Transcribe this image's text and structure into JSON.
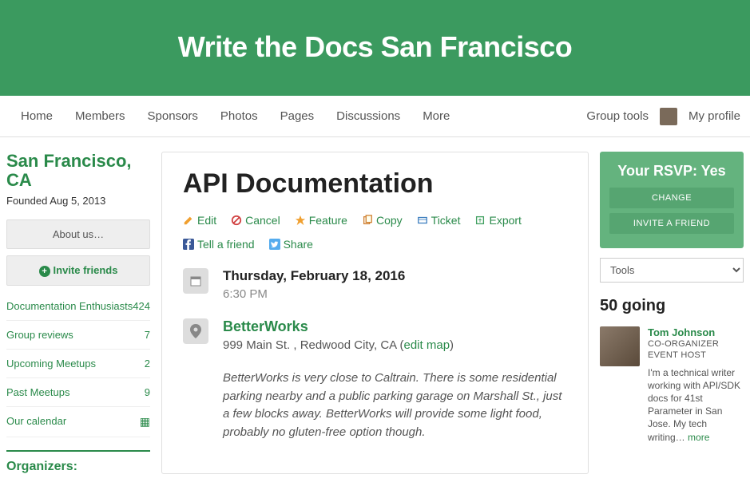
{
  "banner": {
    "title": "Write the Docs San Francisco"
  },
  "nav": {
    "left": [
      "Home",
      "Members",
      "Sponsors",
      "Photos",
      "Pages",
      "Discussions",
      "More"
    ],
    "group_tools": "Group tools",
    "my_profile": "My profile"
  },
  "sidebar": {
    "location": "San Francisco, CA",
    "founded": "Founded Aug 5, 2013",
    "about_btn": "About us…",
    "invite_btn": "Invite friends",
    "stats": [
      {
        "label": "Documentation Enthusiasts",
        "count": "424"
      },
      {
        "label": "Group reviews",
        "count": "7"
      },
      {
        "label": "Upcoming Meetups",
        "count": "2"
      },
      {
        "label": "Past Meetups",
        "count": "9"
      }
    ],
    "calendar_label": "Our calendar",
    "organizers_label": "Organizers:"
  },
  "event": {
    "title": "API Documentation",
    "actions": {
      "edit": "Edit",
      "cancel": "Cancel",
      "feature": "Feature",
      "copy": "Copy",
      "ticket": "Ticket",
      "export": "Export",
      "tell_friend": "Tell a friend",
      "share": "Share"
    },
    "date": "Thursday, February 18, 2016",
    "time": "6:30 PM",
    "venue": "BetterWorks",
    "address": "999 Main St. , Redwood City, CA",
    "edit_map": "edit map",
    "description": "BetterWorks is very close to Caltrain. There is some residential parking nearby and a public parking garage on Marshall St., just a few blocks away. BetterWorks will provide some light food, probably no gluten-free option though."
  },
  "rsvp": {
    "title": "Your RSVP: Yes",
    "change": "CHANGE",
    "invite": "INVITE A FRIEND",
    "tools": "Tools",
    "going_count": "50 going",
    "attendee": {
      "name": "Tom Johnson",
      "role1": "CO-ORGANIZER",
      "role2": "EVENT HOST",
      "bio": "I'm a technical writer working with API/SDK docs for 41st Parameter in San Jose. My tech writing…",
      "more": " more"
    }
  }
}
